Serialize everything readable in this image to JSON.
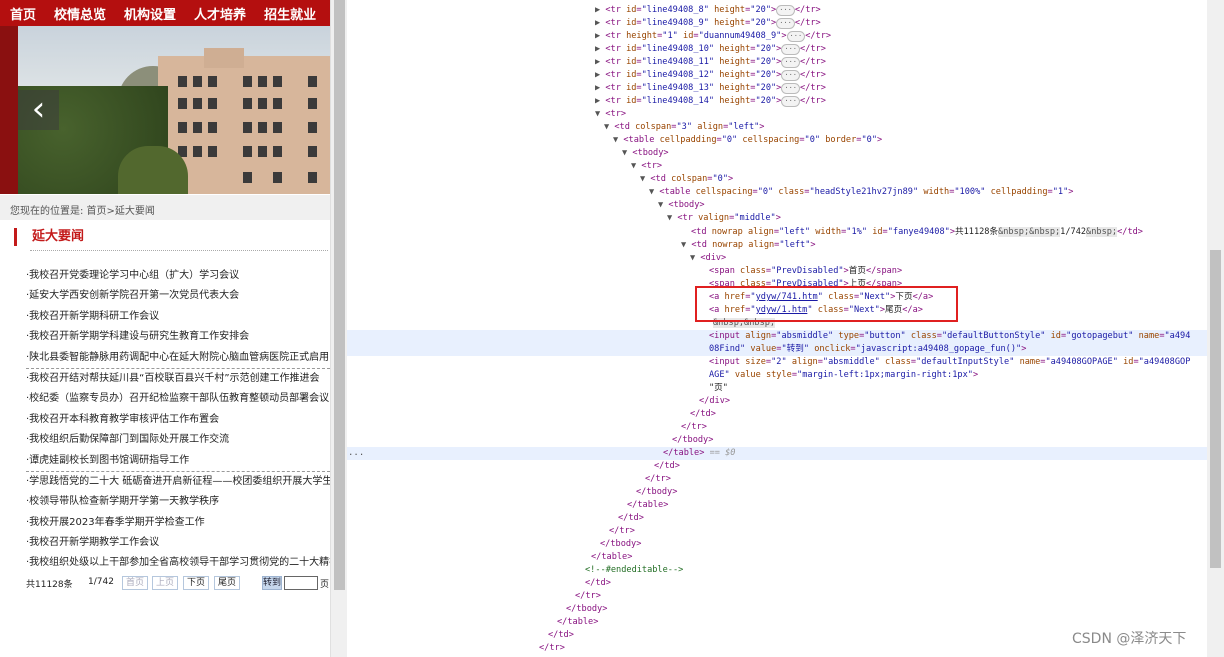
{
  "nav": {
    "items": [
      "首页",
      "校情总览",
      "机构设置",
      "人才培养",
      "招生就业",
      "科"
    ]
  },
  "banner": {
    "prev_arrow": "‹"
  },
  "location": {
    "text": "您现在的位置是:  首页>延大要闻"
  },
  "section": {
    "title": "延大要闻"
  },
  "news": [
    "·我校召开党委理论学习中心组（扩大）学习会议",
    "·延安大学西安创新学院召开第一次党员代表大会",
    "·我校召开新学期科研工作会议",
    "·我校召开新学期学科建设与研究生教育工作安排会",
    "·陕北县委智能静脉用药调配中心在延大附院心脑血管病医院正式启用",
    "·我校召开结对帮扶延川县“百校联百县兴千村”示范创建工作推进会",
    "·校纪委（监察专员办）召开纪检监察干部队伍教育整顿动员部署会议",
    "·我校召开本科教育教学审核评估工作布置会",
    "·我校组织后勤保障部门到国际处开展工作交流",
    "·谭虎娃副校长到图书馆调研指导工作",
    "·学思践悟党的二十大 砥砺奋进开启新征程——校团委组织开展大学生寒",
    "·校领导带队检查新学期开学第一天教学秩序",
    "·我校开展2023年春季学期开学检查工作",
    "·我校召开新学期教学工作会议",
    "·我校组织处级以上干部参加全省高校领导干部学习贯彻党的二十大精神"
  ],
  "pager": {
    "total": "共11128条",
    "page": "1/742",
    "first": "首页",
    "prev": "上页",
    "next": "下页",
    "last": "尾页",
    "go": "转到",
    "suffix": "页"
  },
  "devtools": {
    "gutter_dots": "...",
    "watermark": "CSDN @泽济天下"
  }
}
